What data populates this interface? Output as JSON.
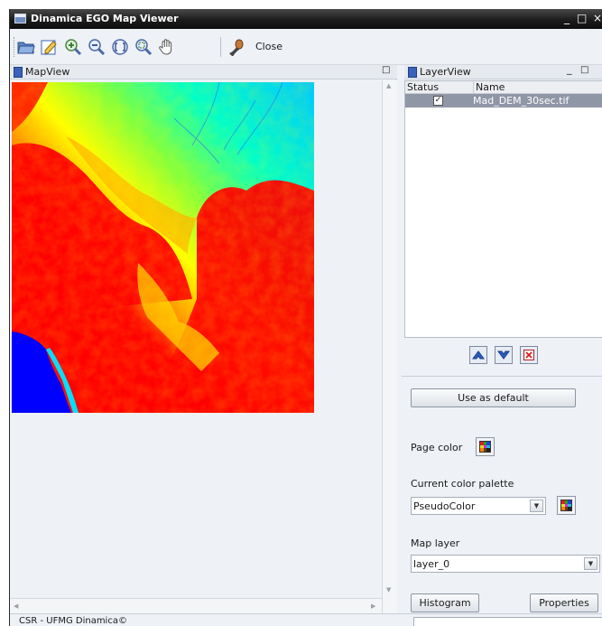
{
  "window": {
    "title": "Dinamica EGO Map Viewer",
    "minimize": "_",
    "maximize": "□",
    "close": "×"
  },
  "toolbar": {
    "tools": [
      "open-folder-icon",
      "edit-map-icon",
      "zoom-in-icon",
      "zoom-out-icon",
      "zoom-fit-icon",
      "zoom-region-icon",
      "pan-hand-icon",
      "color-picker-icon"
    ],
    "close_label": "Close"
  },
  "mapview": {
    "title": "MapView",
    "restore": "□"
  },
  "layerview": {
    "title": "LayerView",
    "min": "_",
    "restore": "□",
    "columns": {
      "status": "Status",
      "name": "Name"
    },
    "layers": [
      {
        "checked": true,
        "check_mark": "✓",
        "name": "Mad_DEM_30sec.tif"
      }
    ]
  },
  "properties": {
    "use_default": "Use as default",
    "page_color_label": "Page color",
    "palette_label": "Current color palette",
    "palette_value": "PseudoColor",
    "map_layer_label": "Map layer",
    "map_layer_value": "layer_0",
    "histogram": "Histogram",
    "properties_btn": "Properties"
  },
  "status": {
    "text": "CSR - UFMG Dinamica©"
  },
  "colors": {
    "titlebar": "#1c1c1c",
    "selection": "#8f96a6",
    "dem_low": "#0000ff",
    "dem_mid": "#ffff00",
    "dem_high": "#ff0000"
  }
}
